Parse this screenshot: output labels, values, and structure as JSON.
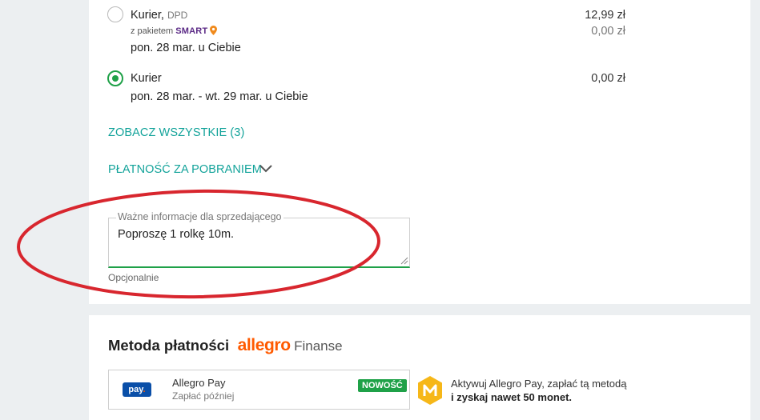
{
  "shipping": {
    "option1": {
      "carrier": "Kurier,",
      "carrier_sub": "DPD",
      "package_prefix": "z pakietem",
      "package_brand": "SMART",
      "delivery": "pon. 28 mar. u Ciebie",
      "price": "12,99 zł",
      "smart_price": "0,00 zł",
      "selected": false
    },
    "option2": {
      "carrier": "Kurier",
      "delivery": "pon. 28 mar. - wt. 29 mar. u Ciebie",
      "price": "0,00 zł",
      "selected": true
    },
    "see_all_link": "ZOBACZ WSZYSTKIE (3)",
    "cod_toggle": "PŁATNOŚĆ ZA POBRANIEM"
  },
  "seller_note": {
    "label": "Ważne informacje dla sprzedającego",
    "value": "Poproszę 1 rolkę 10m.",
    "hint": "Opcjonalnie"
  },
  "payment": {
    "title": "Metoda płatności",
    "brand": "allegro",
    "brand_suffix": "Finanse",
    "method": {
      "logo_text": "pay",
      "name": "Allegro Pay",
      "subtitle": "Zapłać później",
      "badge": "NOWOŚĆ"
    },
    "promo_line1": "Aktywuj Allegro Pay, zapłać tą metodą",
    "promo_line2": "i zyskaj nawet 50 monet."
  },
  "colors": {
    "accent_green": "#1fa148",
    "link_teal": "#13a39a",
    "brand_orange": "#ff5a00",
    "annotation_red": "#d8262e",
    "coin_yellow": "#f6b718"
  },
  "icons": {
    "chevron": "chevron-down-icon",
    "resize": "resize-handle-icon",
    "smart_pin": "location-pin-icon",
    "coin": "monety-coin-icon"
  }
}
